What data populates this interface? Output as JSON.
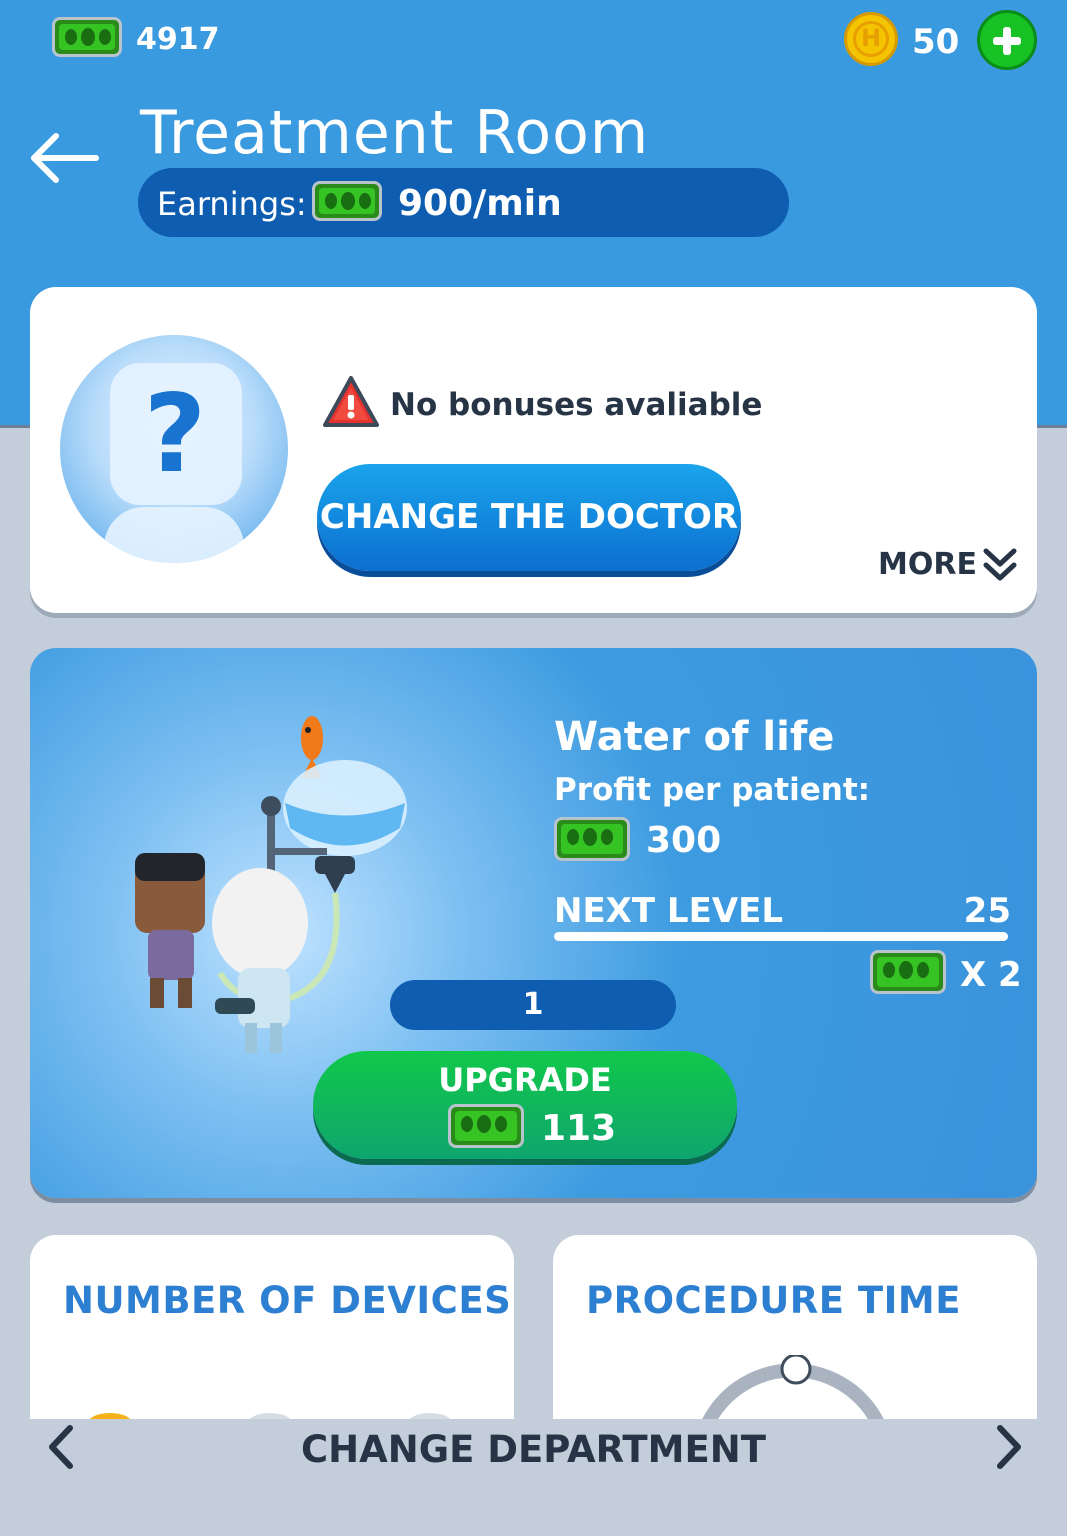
{
  "header": {
    "cash": "4917",
    "coin_symbol": "H",
    "coins": "50",
    "title": "Treatment Room",
    "earnings_label": "Earnings:",
    "earnings_value": "900/min"
  },
  "doctor": {
    "unknown_symbol": "?",
    "no_bonus_text": "No bonuses avaliable",
    "change_button": "CHANGE THE DOCTOR",
    "more_label": "MORE"
  },
  "device": {
    "name": "Water of life",
    "profit_label": "Profit per patient:",
    "profit_value": "300",
    "next_level_label": "NEXT LEVEL",
    "next_level_value": "25",
    "multiplier": "X 2",
    "level": "1",
    "upgrade_label": "UPGRADE",
    "upgrade_cost": "113"
  },
  "stats": {
    "devices_title": "NUMBER OF DEVICES",
    "procedure_title": "PROCEDURE TIME"
  },
  "footer": {
    "change_department": "CHANGE DEPARTMENT"
  },
  "colors": {
    "primary_blue": "#3a9ae0",
    "dark_blue": "#0f5db0",
    "green": "#11c84a",
    "title_blue": "#2d7fd2"
  }
}
